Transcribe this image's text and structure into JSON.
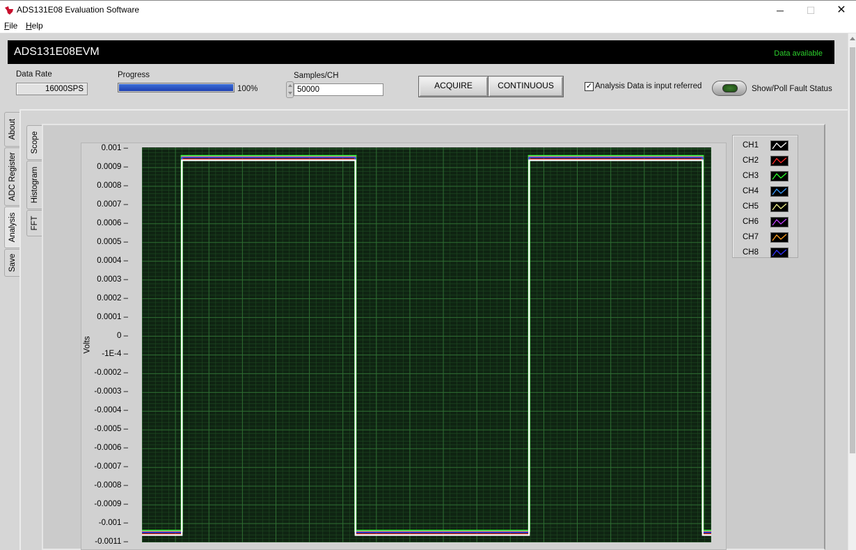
{
  "window": {
    "title": "ADS131E08 Evaluation Software",
    "min_glyph": "─",
    "max_glyph": "☐",
    "close_glyph": "✕"
  },
  "menu": {
    "file": "File",
    "help": "Help"
  },
  "header": {
    "device": "ADS131E08EVM",
    "status": "Data available",
    "status_color": "#2dd12d"
  },
  "controls": {
    "data_rate_label": "Data Rate",
    "data_rate_value": "16000SPS",
    "progress_label": "Progress",
    "progress_value": 100,
    "progress_text": "100%",
    "samples_label": "Samples/CH",
    "samples_value": "50000",
    "acquire_label": "ACQUIRE",
    "continuous_label": "CONTINUOUS",
    "input_referred_label": "Analysis Data is input referred",
    "input_referred_checked": "✓",
    "fault_label": "Show/Poll Fault Status"
  },
  "outer_tabs": [
    "About",
    "ADC Register",
    "Analysis",
    "Save"
  ],
  "inner_tabs": [
    "Scope",
    "Histogram",
    "FFT"
  ],
  "chart_data": {
    "type": "line",
    "ylabel": "Volts",
    "ylim": [
      -0.0011,
      0.001
    ],
    "yticks": [
      "0.001",
      "0.0009",
      "0.0008",
      "0.0007",
      "0.0006",
      "0.0005",
      "0.0004",
      "0.0003",
      "0.0002",
      "0.0001",
      "0",
      "-1E-4",
      "-0.0002",
      "-0.0003",
      "-0.0004",
      "-0.0005",
      "-0.0006",
      "-0.0007",
      "-0.0008",
      "-0.0009",
      "-0.001",
      "-0.0011"
    ],
    "background": "#0f2412",
    "grid": true,
    "waveform": "square",
    "high": 0.00095,
    "low": -0.00105,
    "transitions_fraction": [
      0.07,
      0.375,
      0.68,
      0.985
    ],
    "series": [
      {
        "name": "CH1",
        "color": "#ffffff"
      },
      {
        "name": "CH2",
        "color": "#ff2a2a"
      },
      {
        "name": "CH3",
        "color": "#2cff2c"
      },
      {
        "name": "CH4",
        "color": "#3a9bff"
      },
      {
        "name": "CH5",
        "color": "#f2f28a"
      },
      {
        "name": "CH6",
        "color": "#c040ff"
      },
      {
        "name": "CH7",
        "color": "#ffa020"
      },
      {
        "name": "CH8",
        "color": "#3030ff"
      }
    ]
  }
}
